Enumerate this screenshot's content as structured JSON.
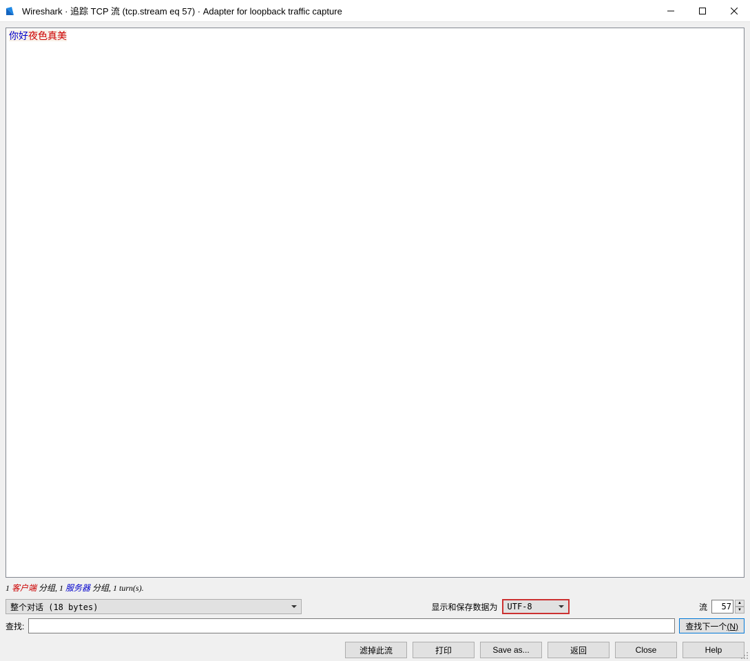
{
  "window": {
    "title": "Wireshark · 追踪 TCP 流 (tcp.stream eq 57) · Adapter for loopback traffic capture"
  },
  "stream": {
    "client_text": "你好",
    "server_text": "夜色真美"
  },
  "status": {
    "part1": "1",
    "client_label": " 客户端 ",
    "part2": "分组, 1",
    "server_label": " 服务器 ",
    "part3": "分组, 1 turn(s)."
  },
  "controls": {
    "conversation_select": "整个对话 (18 bytes)",
    "encoding_label": "显示和保存数据为",
    "encoding_select": "UTF-8",
    "stream_label": "流",
    "stream_value": "57",
    "search_label": "查找:",
    "find_next_label": "查找下一个",
    "find_next_accel": "(N)"
  },
  "buttons": {
    "filter_out": "滤掉此流",
    "print": "打印",
    "save_as": "Save as...",
    "back": "返回",
    "close": "Close",
    "help": "Help"
  }
}
